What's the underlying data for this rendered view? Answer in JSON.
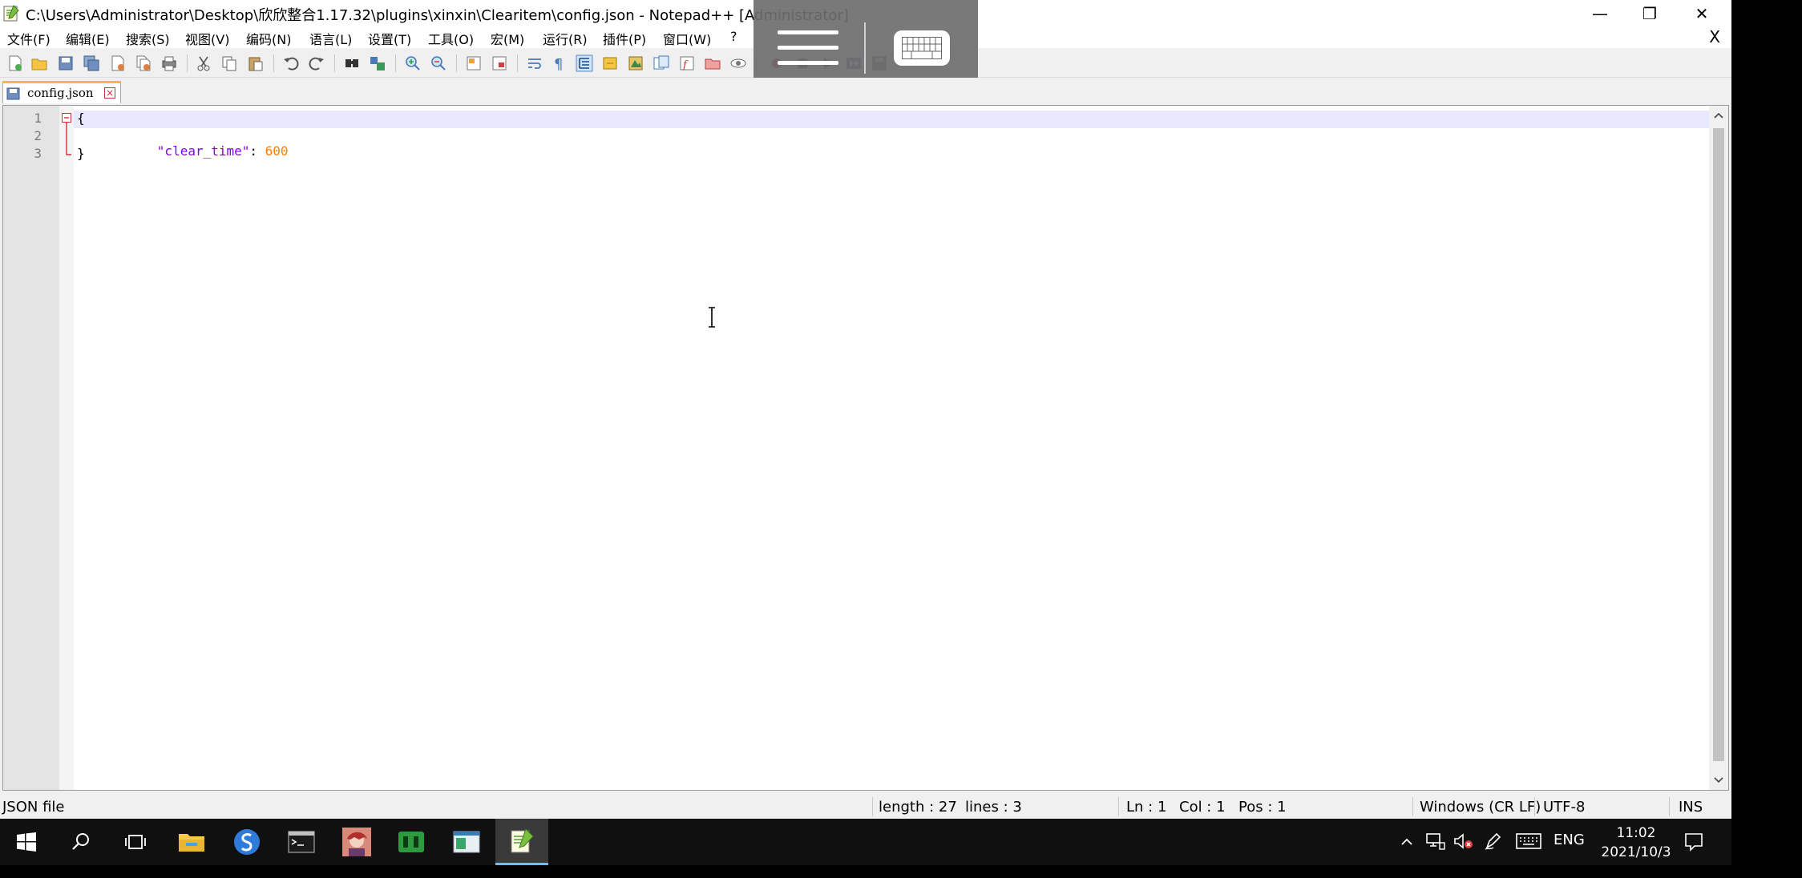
{
  "window": {
    "title": "C:\\Users\\Administrator\\Desktop\\欣欣整合1.17.32\\plugins\\xinxin\\Clearitem\\config.json - Notepad++ [Administrator]",
    "minimize": "—",
    "restore": "❐",
    "close": "✕"
  },
  "menu": {
    "items": [
      "文件(F)",
      "编辑(E)",
      "搜索(S)",
      "视图(V)",
      "编码(N)",
      "语言(L)",
      "设置(T)",
      "工具(O)",
      "宏(M)",
      "运行(R)",
      "插件(P)",
      "窗口(W)",
      "?"
    ],
    "close": "X"
  },
  "tab": {
    "label": "config.json",
    "close": "×"
  },
  "editor": {
    "line_numbers": [
      "1",
      "2",
      "3"
    ],
    "lines": {
      "l1": "{",
      "l2_key": "\"clear_time\"",
      "l2_colon": ": ",
      "l2_value": "600",
      "l3": "}"
    }
  },
  "status": {
    "filetype": "JSON file",
    "length": "length : 27",
    "lines": "lines : 3",
    "ln": "Ln : 1",
    "col": "Col : 1",
    "pos": "Pos : 1",
    "eol": "Windows (CR LF)",
    "encoding": "UTF-8",
    "mode": "INS"
  },
  "taskbar": {
    "lang": "ENG",
    "time": "11:02",
    "date": "2021/10/3"
  },
  "colors": {
    "string": "#8000ff",
    "number": "#ff8000",
    "fold_marker": "#d0303a",
    "active_line": "#e8e8ff"
  }
}
